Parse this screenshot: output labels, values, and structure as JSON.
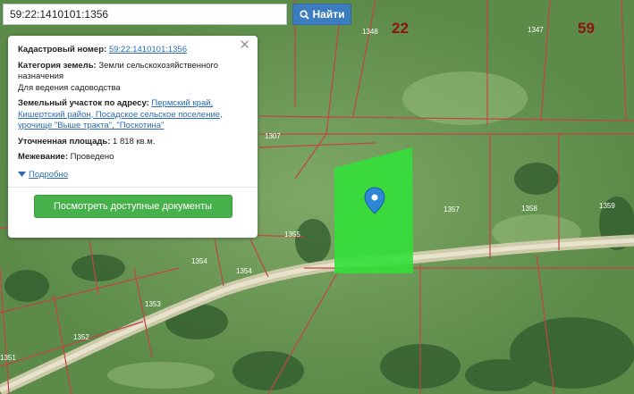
{
  "search": {
    "value": "59:22:1410101:1356",
    "button_label": "Найти",
    "icon": "search-icon"
  },
  "popup": {
    "close_icon": "close-icon",
    "cadastral_label": "Кадастровый номер:",
    "cadastral_value": "59:22:1410101:1356",
    "category_label": "Категория земель:",
    "category_value": "Земли сельскохозяйственного назначения",
    "use_value": "Для ведения садоводства",
    "address_label": "Земельный участок по адресу:",
    "address_value": "Пермский край, Кишертский район, Посадское сельское поселение, урочище \"Выше тракта\", \"Поскотина\"",
    "area_label": "Уточненная площадь:",
    "area_value": "1 818 кв.м.",
    "survey_label": "Межевание:",
    "survey_value": "Проведено",
    "details_label": "Подробно",
    "docs_button": "Посмотреть доступные документы"
  },
  "map": {
    "sector_labels": [
      "22",
      "59"
    ],
    "plot_labels": [
      "1348",
      "1347",
      "1307",
      "1357",
      "1358",
      "1359",
      "1355",
      "1354",
      "1354",
      "1353",
      "1352",
      "1351"
    ],
    "highlight_color": "#33e03a",
    "boundary_color": "#c4434a",
    "marker_color": "#2e86d6",
    "marker_icon": "map-pin-icon"
  }
}
